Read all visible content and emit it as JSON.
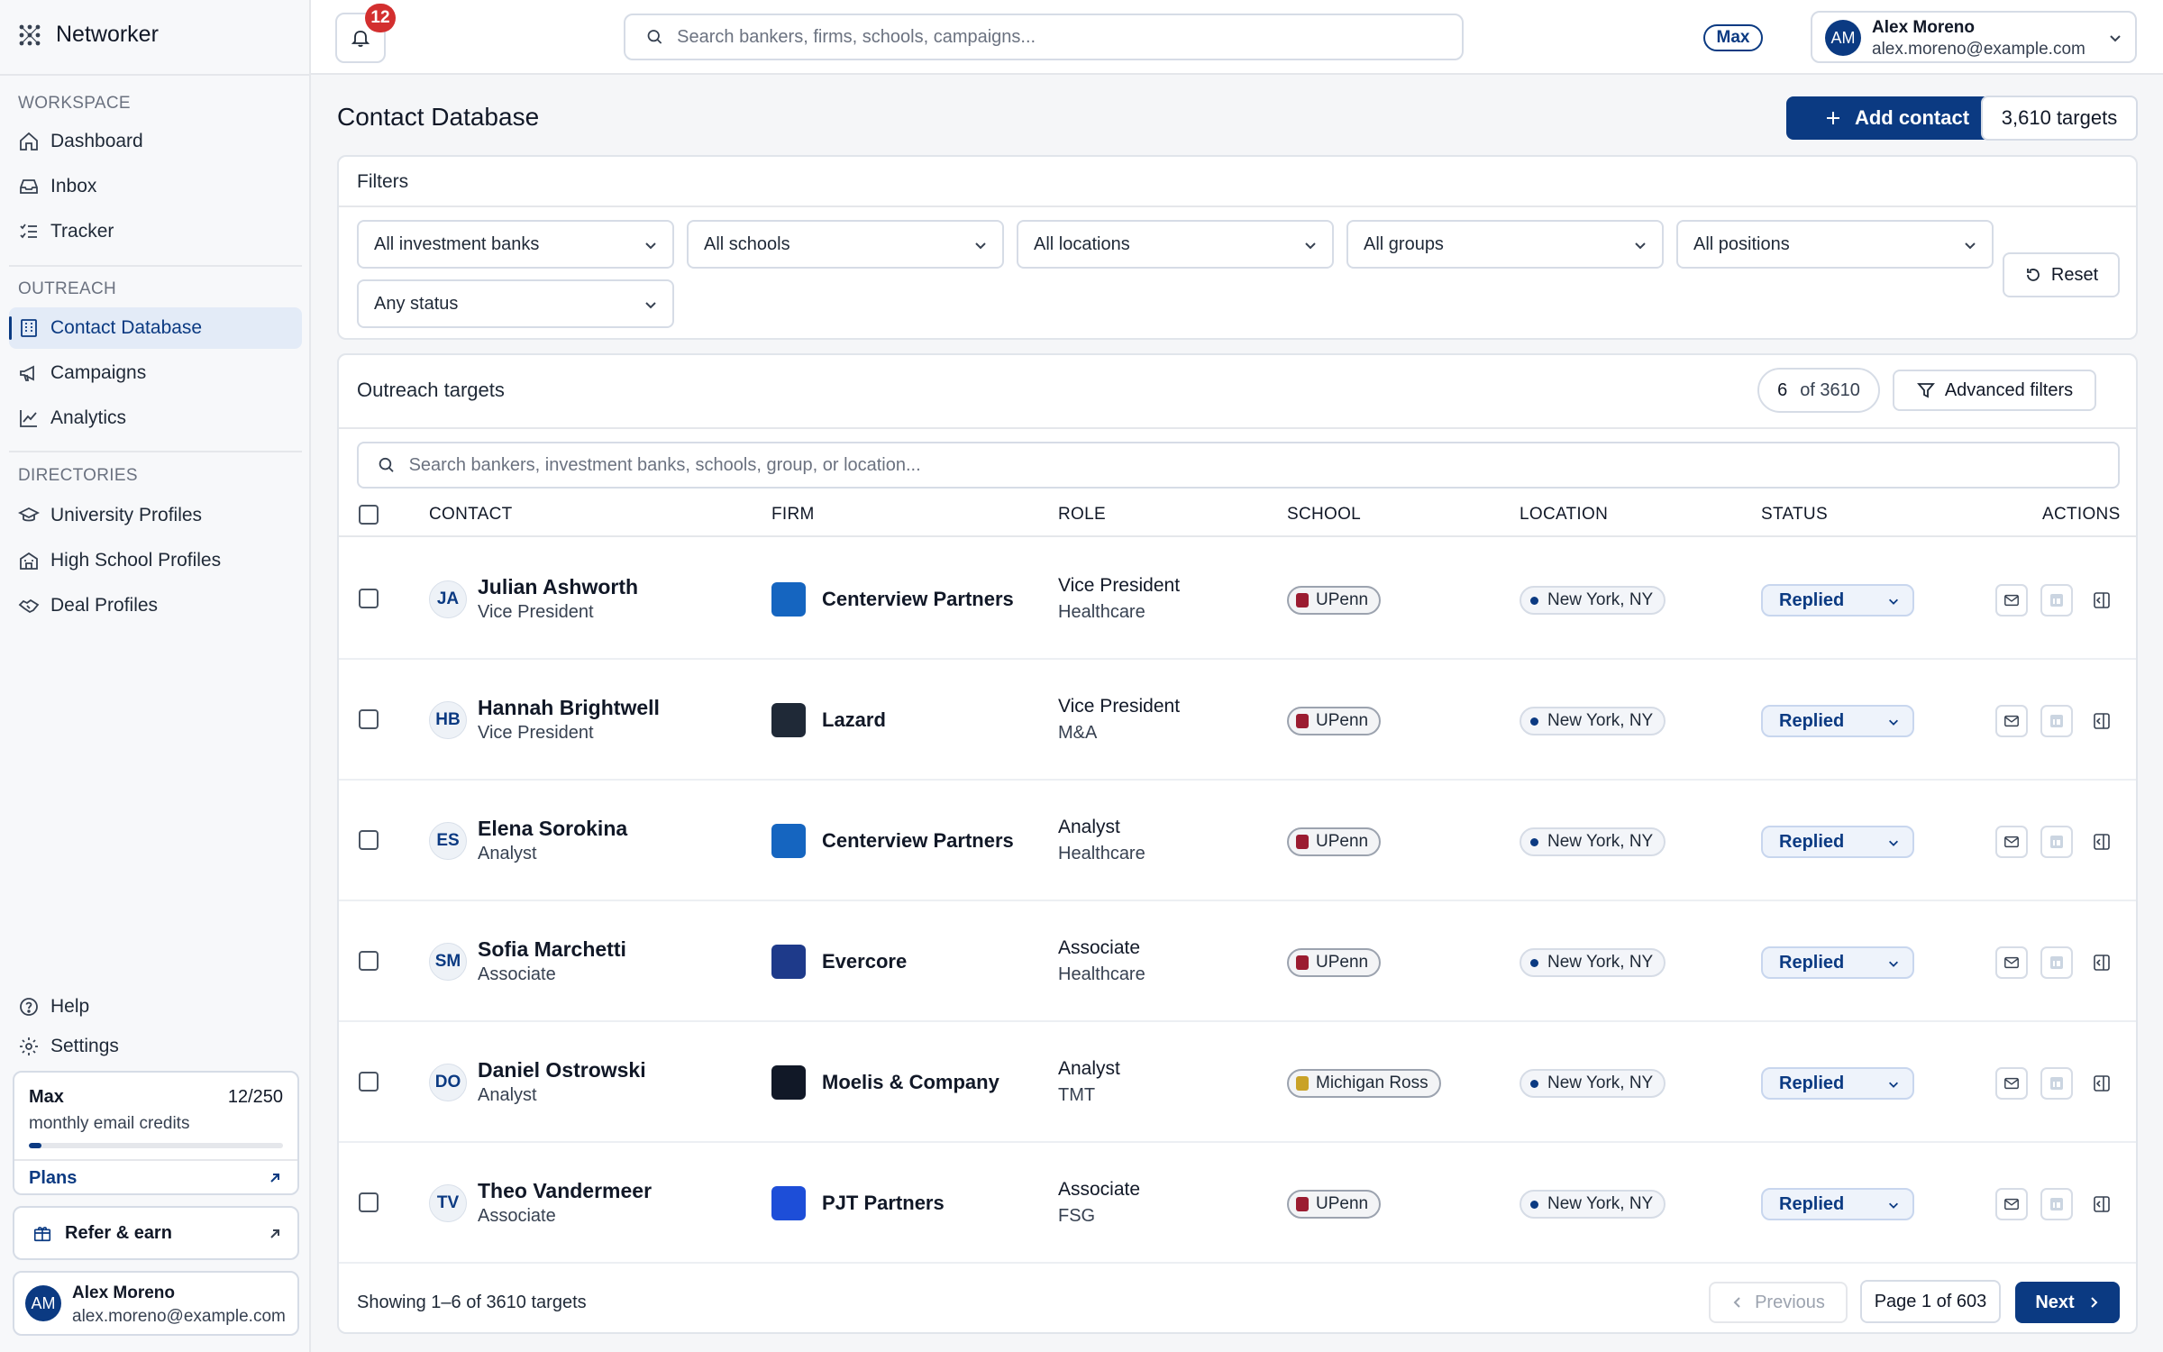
{
  "app": {
    "name": "Networker"
  },
  "colors": {
    "primary": "#0b3a82",
    "badge": "#d32f2f",
    "background": "#f5f6f8"
  },
  "sidebar": {
    "sections": [
      {
        "label": "WORKSPACE",
        "items": [
          {
            "label": "Dashboard",
            "icon": "home-icon"
          },
          {
            "label": "Inbox",
            "icon": "inbox-icon"
          },
          {
            "label": "Tracker",
            "icon": "list-check-icon"
          }
        ]
      },
      {
        "label": "OUTREACH",
        "items": [
          {
            "label": "Contact Database",
            "icon": "building-icon",
            "active": true
          },
          {
            "label": "Campaigns",
            "icon": "megaphone-icon"
          },
          {
            "label": "Analytics",
            "icon": "chart-line-icon"
          }
        ]
      },
      {
        "label": "DIRECTORIES",
        "items": [
          {
            "label": "University Profiles",
            "icon": "graduation-cap-icon"
          },
          {
            "label": "High School Profiles",
            "icon": "school-building-icon"
          },
          {
            "label": "Deal Profiles",
            "icon": "handshake-icon"
          }
        ]
      }
    ],
    "help_label": "Help",
    "settings_label": "Settings",
    "credits": {
      "plan": "Max",
      "used": "12/250",
      "label": "monthly email credits",
      "fraction": 0.048,
      "plans_link": "Plans"
    },
    "refer_label": "Refer & earn",
    "user": {
      "initials": "AM",
      "name": "Alex Moreno",
      "email": "alex.moreno@example.com"
    }
  },
  "topbar": {
    "notification_count": "12",
    "search_placeholder": "Search bankers, firms, schools, campaigns...",
    "plan_badge": "Max",
    "user": {
      "initials": "AM",
      "name": "Alex Moreno",
      "email": "alex.moreno@example.com"
    }
  },
  "page": {
    "title": "Contact Database",
    "add_button": "Add contact",
    "targets_count": "3,610 targets"
  },
  "filters": {
    "title": "Filters",
    "selects": [
      "All investment banks",
      "All schools",
      "All locations",
      "All groups",
      "All positions",
      "Any status"
    ],
    "reset_label": "Reset"
  },
  "targets": {
    "title": "Outreach targets",
    "count_shown": "6",
    "count_total": "of 3610",
    "advanced_label": "Advanced filters",
    "search_placeholder": "Search bankers, investment banks, schools, group, or location...",
    "columns": {
      "contact": "CONTACT",
      "firm": "FIRM",
      "role": "ROLE",
      "school": "SCHOOL",
      "location": "LOCATION",
      "status": "STATUS",
      "actions": "ACTIONS"
    },
    "rows": [
      {
        "initials": "JA",
        "name": "Julian Ashworth",
        "title": "Vice President",
        "firm": "Centerview Partners",
        "firm_color": "#1565c0",
        "role": "Vice President",
        "group": "Healthcare",
        "school": "UPenn",
        "school_color": "#9b1c31",
        "location": "New York, NY",
        "status": "Replied"
      },
      {
        "initials": "HB",
        "name": "Hannah Brightwell",
        "title": "Vice President",
        "firm": "Lazard",
        "firm_color": "#1f2937",
        "role": "Vice President",
        "group": "M&A",
        "school": "UPenn",
        "school_color": "#9b1c31",
        "location": "New York, NY",
        "status": "Replied"
      },
      {
        "initials": "ES",
        "name": "Elena Sorokina",
        "title": "Analyst",
        "firm": "Centerview Partners",
        "firm_color": "#1565c0",
        "role": "Analyst",
        "group": "Healthcare",
        "school": "UPenn",
        "school_color": "#9b1c31",
        "location": "New York, NY",
        "status": "Replied"
      },
      {
        "initials": "SM",
        "name": "Sofia Marchetti",
        "title": "Associate",
        "firm": "Evercore",
        "firm_color": "#1e3a8a",
        "role": "Associate",
        "group": "Healthcare",
        "school": "UPenn",
        "school_color": "#9b1c31",
        "location": "New York, NY",
        "status": "Replied"
      },
      {
        "initials": "DO",
        "name": "Daniel Ostrowski",
        "title": "Analyst",
        "firm": "Moelis & Company",
        "firm_color": "#111827",
        "role": "Analyst",
        "group": "TMT",
        "school": "Michigan Ross",
        "school_color": "#c9a227",
        "location": "New York, NY",
        "status": "Replied"
      },
      {
        "initials": "TV",
        "name": "Theo Vandermeer",
        "title": "Associate",
        "firm": "PJT Partners",
        "firm_color": "#1d4ed8",
        "role": "Associate",
        "group": "FSG",
        "school": "UPenn",
        "school_color": "#9b1c31",
        "location": "New York, NY",
        "status": "Replied"
      }
    ],
    "footer_text": "Showing 1–6 of 3610 targets",
    "prev_label": "Previous",
    "page_indicator": "Page 1 of 603",
    "next_label": "Next"
  }
}
